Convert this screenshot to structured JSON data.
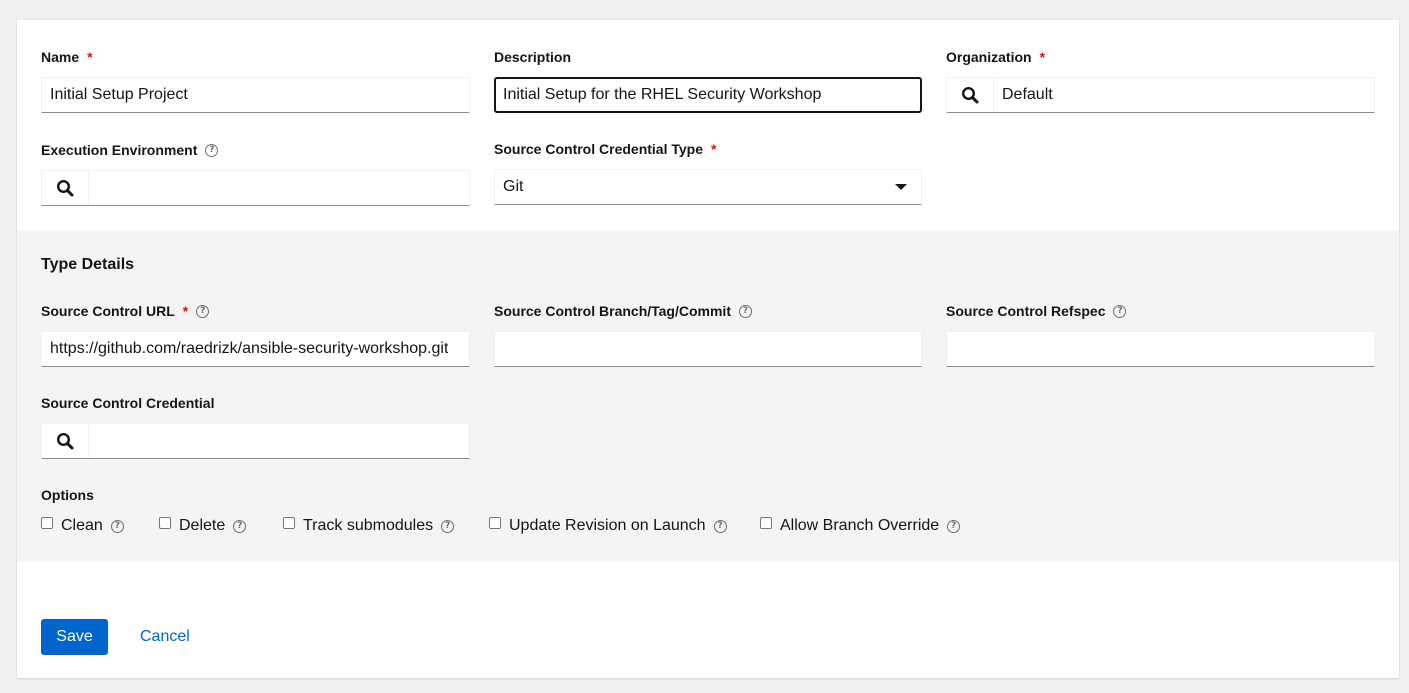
{
  "form": {
    "name": {
      "label": "Name",
      "value": "Initial Setup Project"
    },
    "description": {
      "label": "Description",
      "value": "Initial Setup for the RHEL Security Workshop"
    },
    "organization": {
      "label": "Organization",
      "value": "Default"
    },
    "execution_environment": {
      "label": "Execution Environment",
      "value": ""
    },
    "credential_type": {
      "label": "Source Control Credential Type",
      "value": "Git"
    }
  },
  "type_details": {
    "title": "Type Details",
    "url": {
      "label": "Source Control URL",
      "value": "https://github.com/raedrizk/ansible-security-workshop.git"
    },
    "branch": {
      "label": "Source Control Branch/Tag/Commit",
      "value": ""
    },
    "refspec": {
      "label": "Source Control Refspec",
      "value": ""
    },
    "credential": {
      "label": "Source Control Credential",
      "value": ""
    },
    "options_label": "Options",
    "options": [
      {
        "label": "Clean",
        "checked": false
      },
      {
        "label": "Delete",
        "checked": false
      },
      {
        "label": "Track submodules",
        "checked": false
      },
      {
        "label": "Update Revision on Launch",
        "checked": false
      },
      {
        "label": "Allow Branch Override",
        "checked": false
      }
    ]
  },
  "actions": {
    "save": "Save",
    "cancel": "Cancel"
  },
  "symbols": {
    "required": "*",
    "help": "?"
  },
  "icons": {
    "search": "search-icon",
    "help": "question-circle-icon",
    "caret": "caret-down-icon"
  },
  "colors": {
    "primary": "#0066cc",
    "required": "#c9190b",
    "band": "#f4f4f4"
  }
}
